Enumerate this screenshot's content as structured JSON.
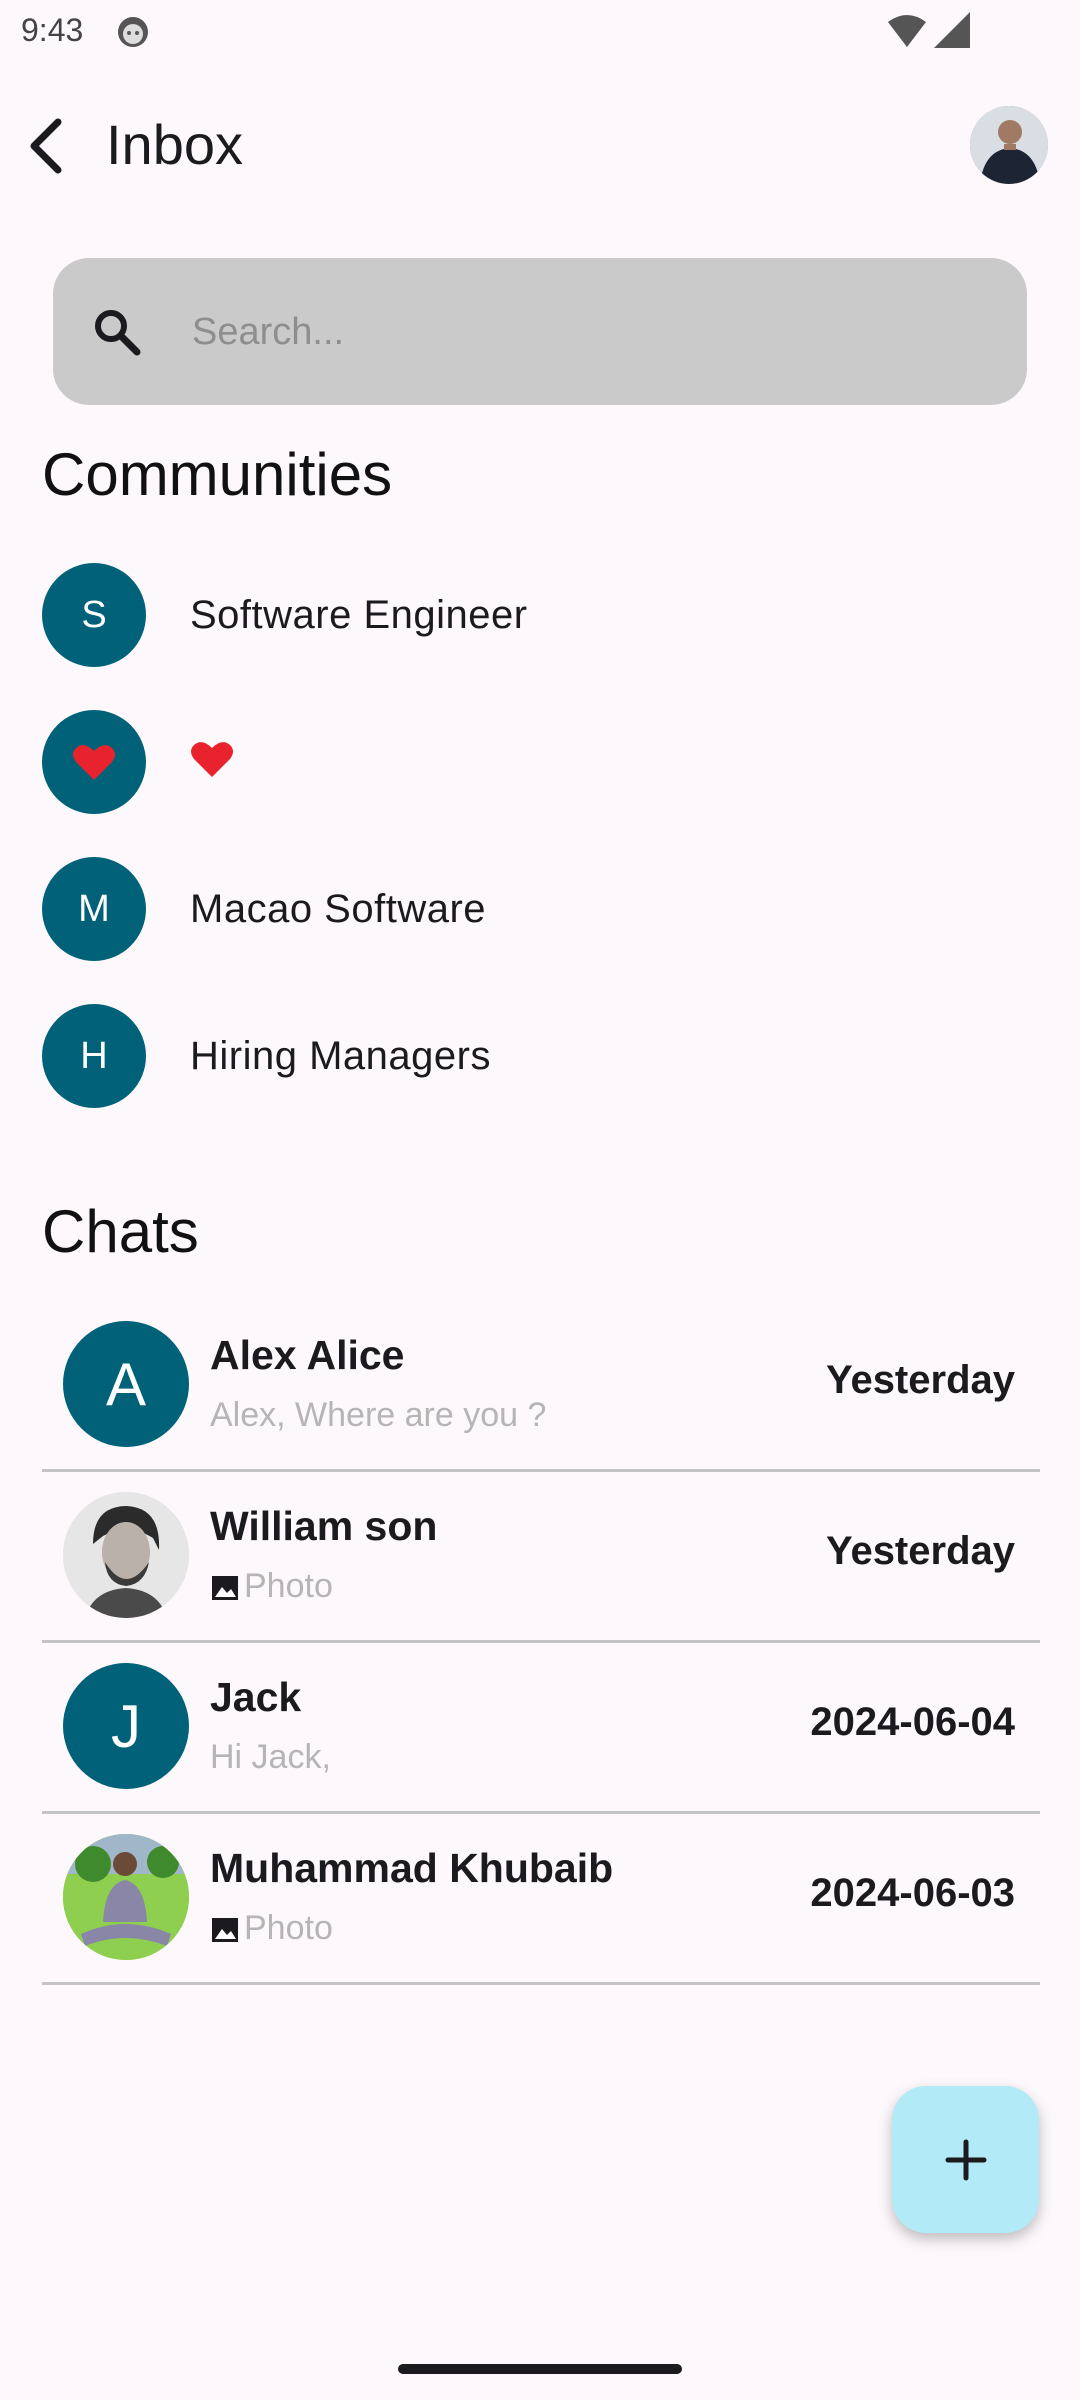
{
  "status_bar": {
    "time": "9:43"
  },
  "app_bar": {
    "title": "Inbox"
  },
  "search": {
    "placeholder": "Search..."
  },
  "communities": {
    "title": "Communities",
    "items": [
      {
        "initial": "S",
        "name": "Software Engineer"
      },
      {
        "initial": "",
        "name": ""
      },
      {
        "initial": "M",
        "name": "Macao Software"
      },
      {
        "initial": "H",
        "name": "Hiring Managers"
      }
    ]
  },
  "chats": {
    "title": "Chats",
    "items": [
      {
        "initial": "A",
        "name": "Alex Alice",
        "preview": "Alex, Where are you ?",
        "time": "Yesterday"
      },
      {
        "initial": "",
        "name": "William son",
        "preview": "Photo",
        "time": "Yesterday"
      },
      {
        "initial": "J",
        "name": "Jack",
        "preview": "Hi Jack,",
        "time": "2024-06-04"
      },
      {
        "initial": "",
        "name": "Muhammad Khubaib",
        "preview": "Photo",
        "time": "2024-06-03"
      }
    ]
  },
  "colors": {
    "accent": "#006178",
    "fab": "#b2ebf7",
    "background": "#fdf8fc",
    "search_bg": "#cacaca",
    "heart": "#e8232e"
  },
  "icons": {
    "back": "arrow-back-icon",
    "search": "search-icon",
    "fab": "plus-icon",
    "photo": "image-icon"
  }
}
